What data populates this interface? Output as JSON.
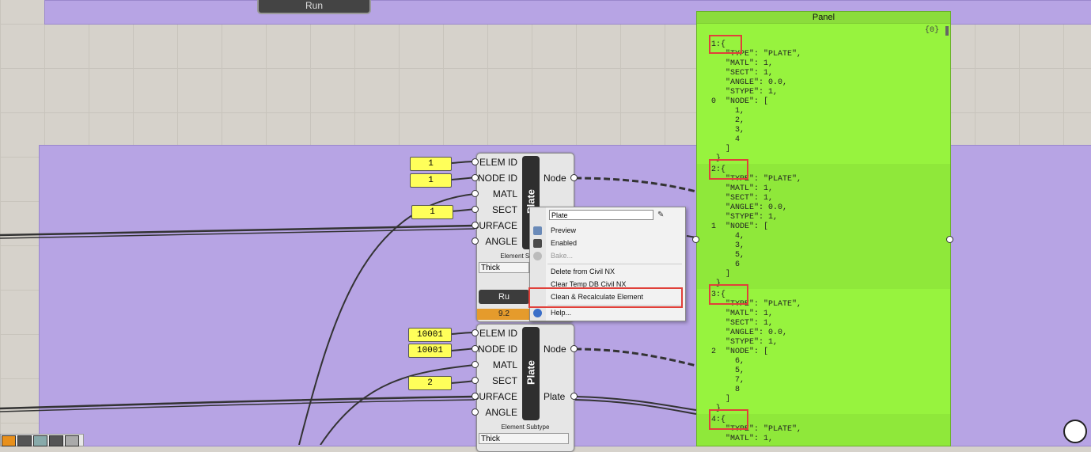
{
  "top_component": {
    "run_label": "Run"
  },
  "component1": {
    "inputs": [
      "ELEM ID",
      "NODE ID",
      "MATL",
      "SECT",
      "SURFACE",
      "ANGLE"
    ],
    "name": "Plate",
    "output": "Node",
    "element_subtype_label": "Element Se",
    "subtype_value": "Thick",
    "run_label": "Ru",
    "progress_text": "9.2"
  },
  "component1_values": {
    "elem_id": "1",
    "node_id": "1",
    "sect": "1"
  },
  "component2": {
    "inputs": [
      "ELEM ID",
      "NODE ID",
      "MATL",
      "SECT",
      "SURFACE",
      "ANGLE"
    ],
    "name": "Plate",
    "outputs": [
      "Node",
      "Plate"
    ],
    "element_subtype_label": "Element Subtype",
    "subtype_value": "Thick"
  },
  "component2_values": {
    "elem_id": "10001",
    "node_id": "10001",
    "sect": "2"
  },
  "context_menu": {
    "name_value": "Plate",
    "items": {
      "preview": "Preview",
      "enabled": "Enabled",
      "bake": "Bake...",
      "delete": "Delete from Civil NX",
      "clear_temp": "Clear Temp DB Civil NX",
      "clean_recalc": "Clean & Recalculate Element",
      "help": "Help..."
    }
  },
  "panel": {
    "title": "Panel",
    "path": "{0}",
    "entries": [
      {
        "index": "0",
        "text": "1:{\n   \"TYPE\": \"PLATE\",\n   \"MATL\": 1,\n   \"SECT\": 1,\n   \"ANGLE\": 0.0,\n   \"STYPE\": 1,\n   \"NODE\": [\n     1,\n     2,\n     3,\n     4\n   ]\n }"
      },
      {
        "index": "1",
        "text": "2:{\n   \"TYPE\": \"PLATE\",\n   \"MATL\": 1,\n   \"SECT\": 1,\n   \"ANGLE\": 0.0,\n   \"STYPE\": 1,\n   \"NODE\": [\n     4,\n     3,\n     5,\n     6\n   ]\n }"
      },
      {
        "index": "2",
        "text": "3:{\n   \"TYPE\": \"PLATE\",\n   \"MATL\": 1,\n   \"SECT\": 1,\n   \"ANGLE\": 0.0,\n   \"STYPE\": 1,\n   \"NODE\": [\n     6,\n     5,\n     7,\n     8\n   ]\n }"
      },
      {
        "index": "3",
        "text": "4:{\n   \"TYPE\": \"PLATE\",\n   \"MATL\": 1,"
      }
    ]
  },
  "colors": {
    "group": "#b7a4e4",
    "panel": "#97f33e",
    "highlight": "#e0403a",
    "progress": "#e59b2c"
  }
}
